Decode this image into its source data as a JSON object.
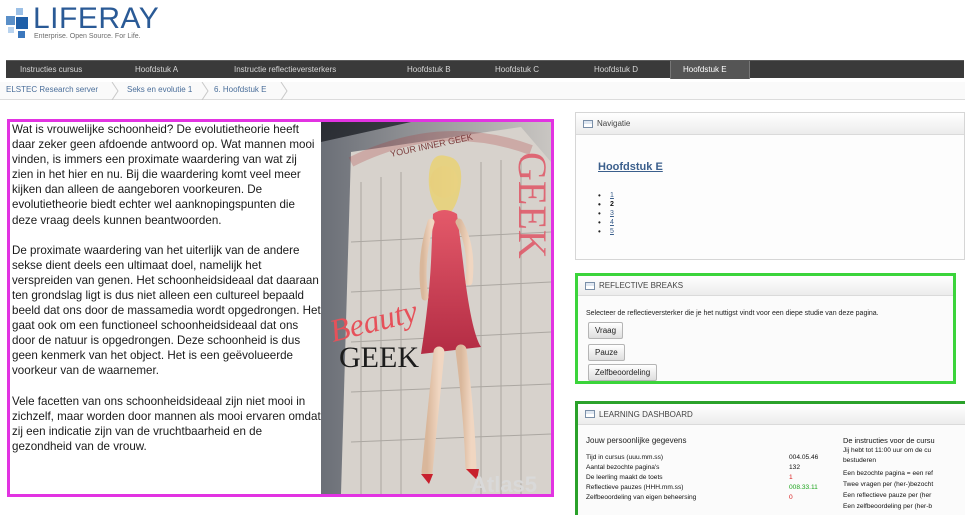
{
  "header": {
    "logo_text": "LIFERAY",
    "logo_tagline": "Enterprise. Open Source. For Life."
  },
  "nav": {
    "tabs": [
      {
        "label": "Instructies cursus",
        "active": false
      },
      {
        "label": "Hoofdstuk A",
        "active": false
      },
      {
        "label": "Instructie reflectieversterkers",
        "active": false
      },
      {
        "label": "Hoofdstuk B",
        "active": false
      },
      {
        "label": "Hoofdstuk C",
        "active": false
      },
      {
        "label": "Hoofdstuk D",
        "active": false
      },
      {
        "label": "Hoofdstuk E",
        "active": true
      }
    ]
  },
  "breadcrumb": [
    "ELSTEC Research server",
    "Seks en evolutie 1",
    "6. Hoofdstuk E"
  ],
  "article": {
    "paragraphs": [
      "Wat is vrouwelijke schoonheid? De evolutietheorie heeft daar zeker geen afdoende antwoord op. Wat mannen mooi vinden, is immers een proximate waardering van wat zij zien in het hier en nu. Bij die waardering komt veel meer kijken dan alleen de aangeboren voorkeuren. De evolutietheorie biedt echter wel aanknopingspunten die deze vraag deels kunnen beantwoorden.",
      "De proximate waardering van het uiterlijk van de andere sekse dient deels een ultimaat doel, namelijk het verspreiden van genen. Het schoonheidsideaal dat daaraan ten grondslag ligt is dus niet alleen een cultureel bepaald beeld dat ons door de massamedia wordt opgedrongen. Het gaat ook om een functioneel schoonheidsideaal dat ons door de natuur is opgedrongen. Deze schoonheid is dus geen kenmerk van het object. Het is een geëvolueerde voorkeur van de waarnemer.",
      "Vele facetten van ons schoonheidsideaal zijn niet mooi in zichzelf, maar worden door mannen als mooi ervaren omdat zij een indicatie zijn van de vruchtbaarheid en de gezondheid van de vrouw."
    ],
    "poster_text": {
      "beauty": "Beauty",
      "geek_left": "GEEK",
      "geek_right": "GEEK",
      "top": "YOUR INNER GEEK",
      "bottom": "Atlas5"
    }
  },
  "navigatie": {
    "header": "Navigatie",
    "title": "Hoofdstuk E",
    "items": [
      "1",
      "2",
      "3",
      "4",
      "5"
    ],
    "current_index": 1
  },
  "reflective_breaks": {
    "header": "REFLECTIVE BREAKS",
    "intro": "Selecteer de reflectieversterker die je het nuttigst vindt voor een diepe studie van deze pagina.",
    "buttons": [
      "Vraag",
      "Pauze",
      "Zelfbeoordeling"
    ]
  },
  "learning_dashboard": {
    "header": "LEARNING DASHBOARD",
    "left_heading": "Jouw persoonlijke gegevens",
    "rows": [
      {
        "label": "Tijd in cursus (uuu.mm.ss)",
        "value": "004.05.46",
        "color": "#111111"
      },
      {
        "label": "Aantal bezochte pagina's",
        "value": "132",
        "color": "#111111"
      },
      {
        "label": "De leerling maakt de toets",
        "value": "1",
        "color": "#d81c1c"
      },
      {
        "label": "Reflectieve pauzes (HHH.mm.ss)",
        "value": "008.33.11",
        "color": "#1ea51e"
      },
      {
        "label": "Zelfbeoordeling van eigen beheersing",
        "value": "0",
        "color": "#d81c1c"
      }
    ],
    "right_lines": [
      "De instructies voor de cursu",
      "Jij hebt tot 11:00 uur om de cu",
      "bestuderen",
      "Een bezochte pagina = een ref",
      "Twee vragen per (her-)bezocht",
      "Een reflectieve pauze per (her",
      "Een zelfbeoordeling per (her-b"
    ]
  },
  "colors": {
    "article_frame": "#e233e2",
    "reflective_frame": "#3bd43b",
    "dashboard_frame": "#2aa12a",
    "nav_bar": "#3a3a3a",
    "link": "#3b5f8c"
  }
}
